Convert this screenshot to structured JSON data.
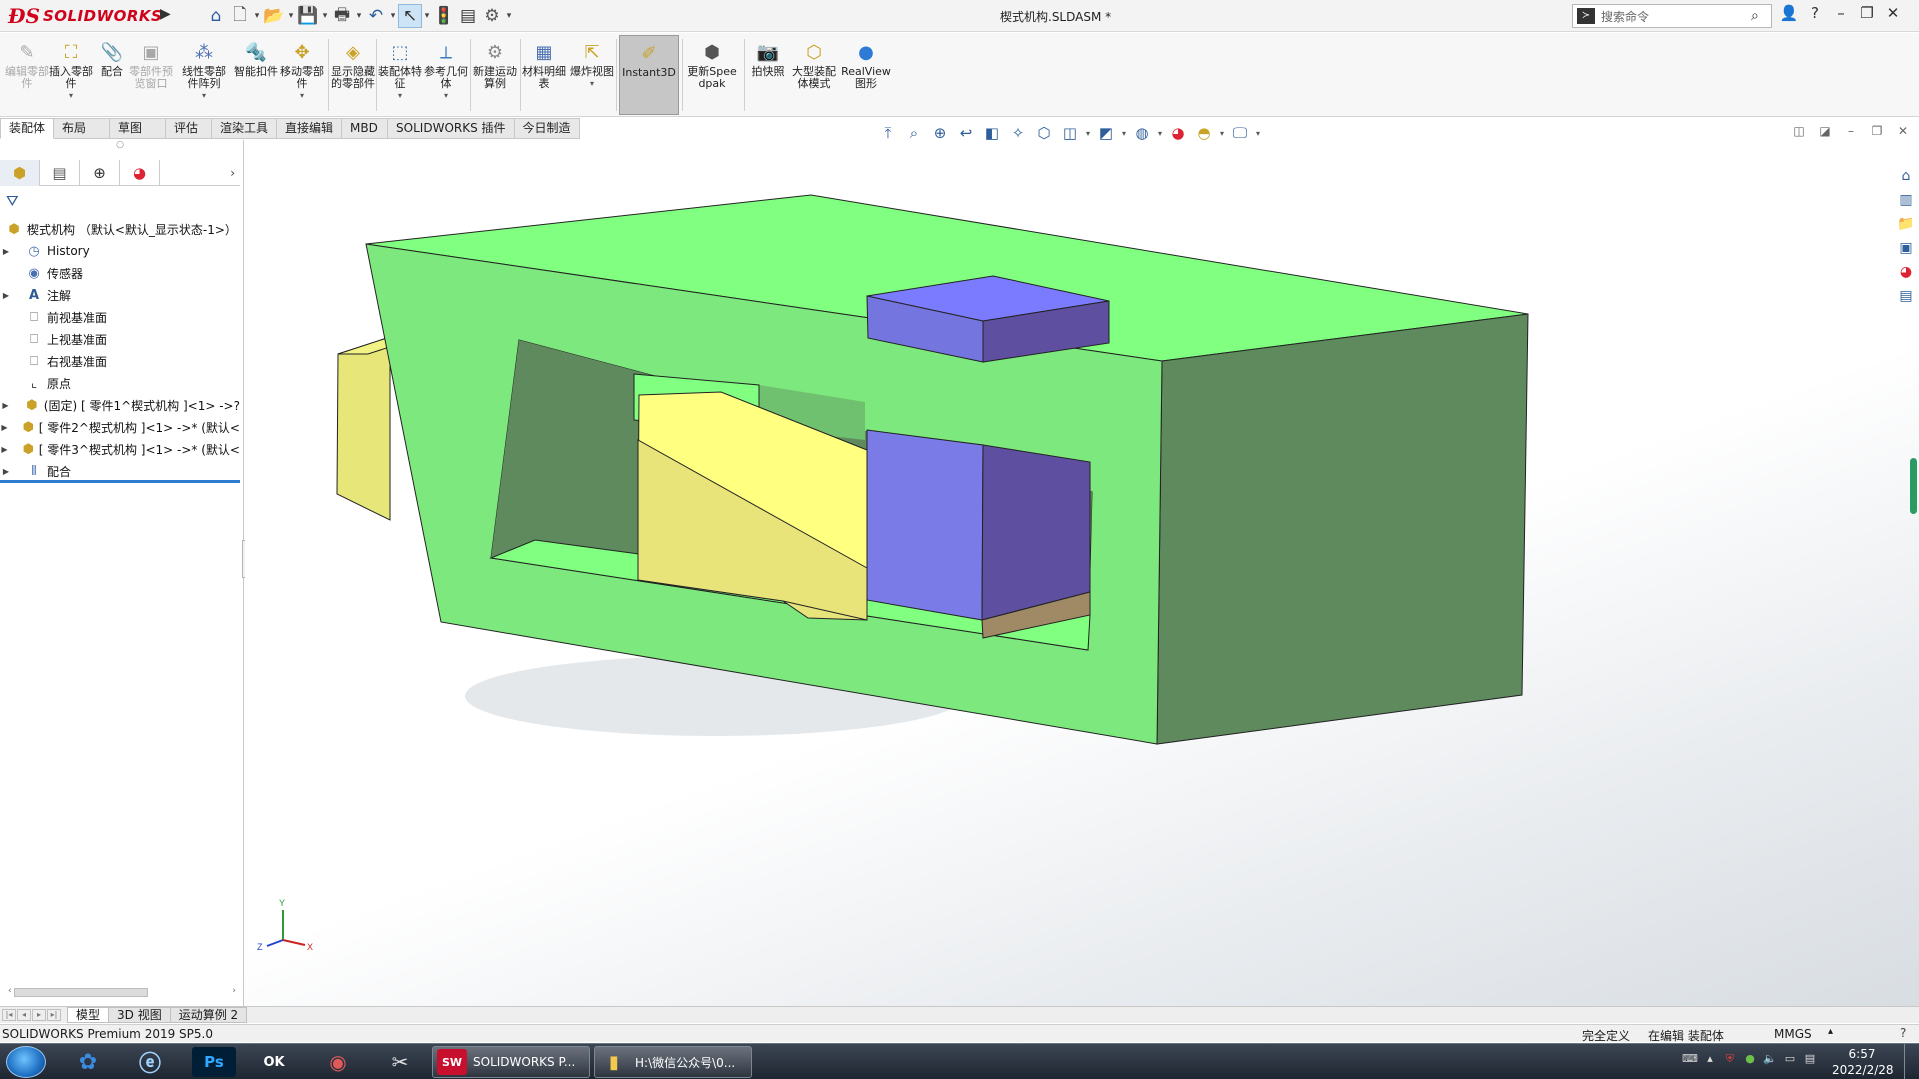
{
  "app": {
    "logo_text": "SOLIDWORKS",
    "doc_title": "楔式机构.SLDASM *",
    "search_placeholder": "搜索命令"
  },
  "quick_access": [
    "home-icon",
    "new-icon",
    "open-icon",
    "save-icon",
    "print-icon",
    "undo-icon",
    "select-icon",
    "rebuild-icon",
    "file-props-icon",
    "options-icon"
  ],
  "ribbon": {
    "buttons": [
      {
        "label": "编辑零部件",
        "disabled": true
      },
      {
        "label": "插入零部件",
        "disabled": false
      },
      {
        "label": "配合",
        "disabled": false
      },
      {
        "label": "零部件预览窗口",
        "disabled": true
      },
      {
        "label": "线性零部件阵列",
        "disabled": false
      },
      {
        "label": "智能扣件",
        "disabled": false
      },
      {
        "label": "移动零部件",
        "disabled": false
      },
      {
        "label": "显示隐藏的零部件",
        "disabled": false
      },
      {
        "label": "装配体特征",
        "disabled": false
      },
      {
        "label": "参考几何体",
        "disabled": false
      },
      {
        "label": "新建运动算例",
        "disabled": false
      },
      {
        "label": "材料明细表",
        "disabled": false
      },
      {
        "label": "爆炸视图",
        "disabled": false
      },
      {
        "label": "Instant3D",
        "disabled": false
      },
      {
        "label": "更新Speedpak",
        "disabled": false
      },
      {
        "label": "拍快照",
        "disabled": false
      },
      {
        "label": "大型装配体模式",
        "disabled": false
      },
      {
        "label": "RealView图形",
        "disabled": false
      }
    ]
  },
  "command_tabs": [
    "装配体",
    "布局",
    "草图",
    "评估",
    "渲染工具",
    "直接编辑",
    "MBD",
    "SOLIDWORKS 插件",
    "今日制造"
  ],
  "feature_tree": {
    "root": "楔式机构 （默认<默认_显示状态-1>）",
    "items": [
      {
        "label": "History",
        "icon": "history-icon",
        "expand": true
      },
      {
        "label": "传感器",
        "icon": "sensor-icon",
        "expand": false
      },
      {
        "label": "注解",
        "icon": "annotation-icon",
        "expand": true
      },
      {
        "label": "前视基准面",
        "icon": "plane-icon",
        "expand": false
      },
      {
        "label": "上视基准面",
        "icon": "plane-icon",
        "expand": false
      },
      {
        "label": "右视基准面",
        "icon": "plane-icon",
        "expand": false
      },
      {
        "label": "原点",
        "icon": "origin-icon",
        "expand": false
      },
      {
        "label": "(固定) [ 零件1^楔式机构 ]<1> ->?",
        "icon": "part-icon",
        "expand": true
      },
      {
        "label": "[ 零件2^楔式机构 ]<1> ->* (默认<",
        "icon": "part-icon",
        "expand": true
      },
      {
        "label": "[ 零件3^楔式机构 ]<1> ->* (默认<",
        "icon": "part-icon",
        "expand": true
      },
      {
        "label": "配合",
        "icon": "mates-icon",
        "expand": true
      }
    ]
  },
  "model_tabs": [
    "模型",
    "3D 视图",
    "运动算例 2"
  ],
  "status": {
    "left": "SOLIDWORKS Premium 2019 SP5.0",
    "defined": "完全定义",
    "editing": "在编辑 装配体",
    "units": "MMGS"
  },
  "taskbar": {
    "tasks": [
      {
        "label": "SOLIDWORKS P..."
      },
      {
        "label": "H:\\微信公众号\\0..."
      }
    ],
    "time": "6:57",
    "date": "2022/2/28"
  },
  "colors": {
    "frame_green": "#80ff80",
    "frame_dark": "#5e8a5e",
    "wedge_yellow": "#ffff80",
    "block_blue": "#7b7be8",
    "block_blue_dark": "#5e4fa0"
  },
  "triad_labels": {
    "x": "X",
    "y": "Y",
    "z": "Z"
  }
}
